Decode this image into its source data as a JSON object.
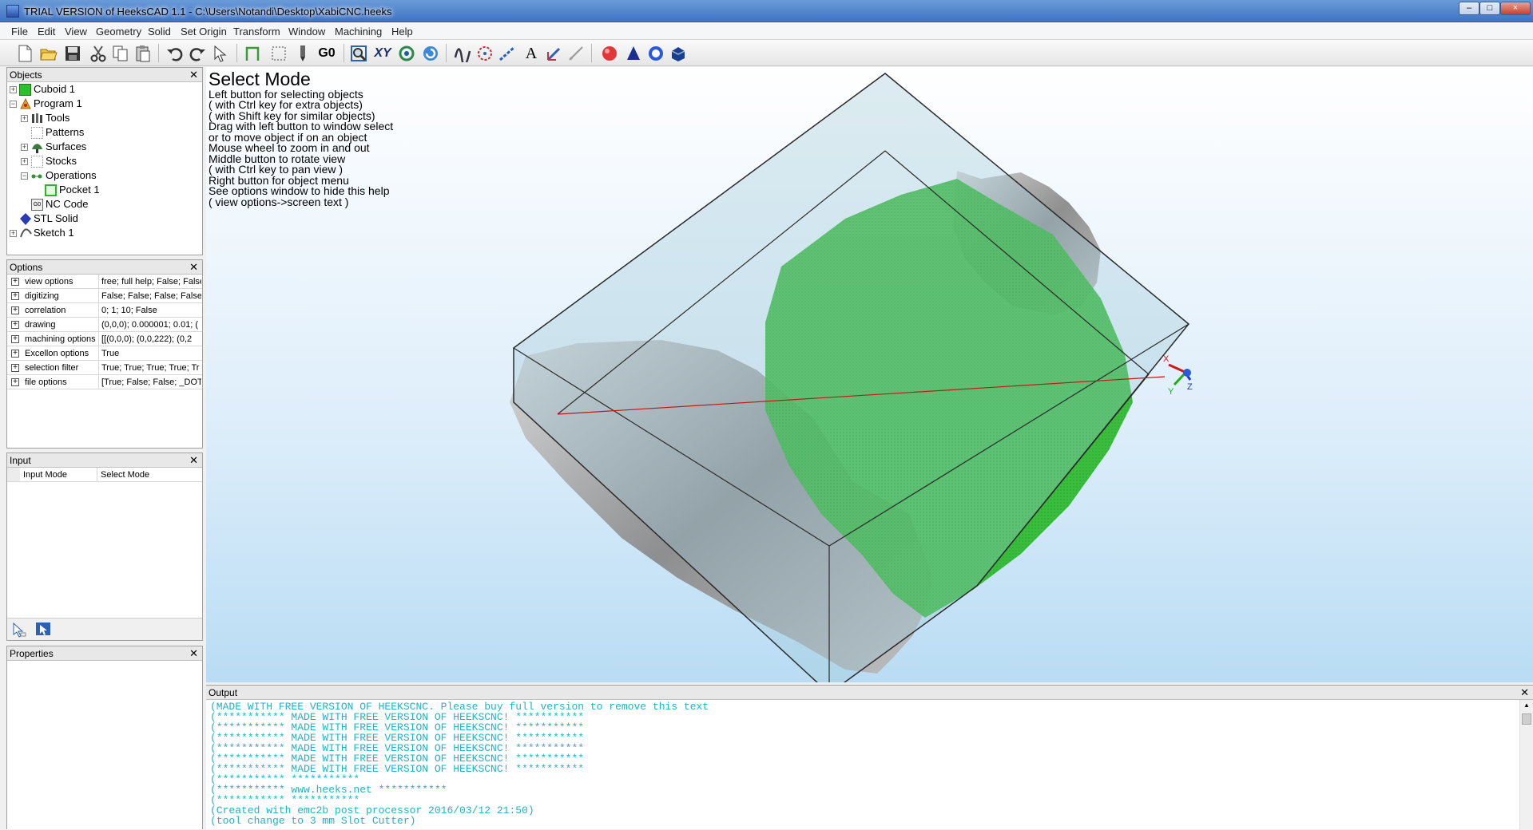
{
  "window": {
    "title": "TRIAL VERSION of HeeksCAD 1.1 - C:\\Users\\Notandi\\Desktop\\XabiCNC.heeks",
    "minimize": "–",
    "maximize": "□",
    "close": "×"
  },
  "menu": [
    "File",
    "Edit",
    "View",
    "Geometry",
    "Solid",
    "Set Origin",
    "Transform",
    "Window",
    "Machining",
    "Help"
  ],
  "toolbar": {
    "text_buttons": {
      "xy": "XY",
      "g0": "G0",
      "text": "A"
    },
    "icons": [
      "new-icon",
      "open-icon",
      "save-icon",
      "cut-icon",
      "copy-icon",
      "paste-icon",
      "undo-icon",
      "redo-icon",
      "select-icon",
      "profile-icon",
      "pocket-icon",
      "drill-icon",
      "g0-icon",
      "zoom-window-icon",
      "view-xy-icon",
      "fit-view-icon",
      "redraw-icon",
      "spline-icon",
      "circle-icon",
      "lines-icon",
      "text-icon",
      "coordinate-system-icon",
      "dimension-icon",
      "sphere-icon",
      "cone-icon",
      "cylinder-icon",
      "cuboid-icon"
    ]
  },
  "objects_panel": {
    "title": "Objects",
    "items": [
      {
        "label": "Cuboid 1",
        "icon": "cuboid-icon"
      },
      {
        "label": "Program 1",
        "icon": "program-icon"
      },
      {
        "label": "Tools",
        "icon": "tools-icon"
      },
      {
        "label": "Patterns",
        "icon": "patterns-icon"
      },
      {
        "label": "Surfaces",
        "icon": "surfaces-icon"
      },
      {
        "label": "Stocks",
        "icon": "stocks-icon"
      },
      {
        "label": "Operations",
        "icon": "operations-icon"
      },
      {
        "label": "Pocket 1",
        "icon": "pocket-icon"
      },
      {
        "label": "NC Code",
        "icon": "nc-code-icon"
      },
      {
        "label": "STL Solid",
        "icon": "stl-solid-icon"
      },
      {
        "label": "Sketch 1",
        "icon": "sketch-icon"
      }
    ]
  },
  "options_panel": {
    "title": "Options",
    "rows": [
      {
        "name": "view options",
        "value": "free; full help; False; False"
      },
      {
        "name": "digitizing",
        "value": "False; False; False; False;"
      },
      {
        "name": "correlation",
        "value": "0; 1; 10; False"
      },
      {
        "name": "drawing",
        "value": "(0,0,0); 0.000001; 0.01; ("
      },
      {
        "name": "machining options",
        "value": "[[(0,0,0); (0,0,222); (0,2"
      },
      {
        "name": "Excellon options",
        "value": "True"
      },
      {
        "name": "selection filter",
        "value": "True; True; True; True; Tr"
      },
      {
        "name": "file options",
        "value": "[True; False; False; _DOT"
      }
    ]
  },
  "input_panel": {
    "title": "Input",
    "name": "Input Mode",
    "value": "Select Mode"
  },
  "properties_panel": {
    "title": "Properties"
  },
  "viewport": {
    "help_title": "Select Mode",
    "help_lines": [
      "Left button for selecting objects",
      "( with Ctrl key for extra objects)",
      "( with Shift key for similar objects)",
      "Drag with left button to window select",
      "or to move object if on an object",
      "Mouse wheel to zoom in and out",
      "Middle button to rotate view",
      "( with Ctrl key to pan view )",
      "Right button for object menu",
      "See options window to hide this help",
      "( view options->screen text )"
    ],
    "axis_labels": {
      "x": "X",
      "y": "Y",
      "z": "Z"
    }
  },
  "output_panel": {
    "title": "Output",
    "lines": [
      "(MADE WITH FREE VERSION OF HEEKSCNC. Please buy full version to remove this text",
      "(*********** MADE WITH FREE VERSION OF HEEKSCNC! ***********",
      "(*********** MADE WITH FREE VERSION OF HEEKSCNC! ***********",
      "(*********** MADE WITH FREE VERSION OF HEEKSCNC! ***********",
      "(*********** MADE WITH FREE VERSION OF HEEKSCNC! ***********",
      "(*********** MADE WITH FREE VERSION OF HEEKSCNC! ***********",
      "(*********** MADE WITH FREE VERSION OF HEEKSCNC! ***********",
      "(*********** ***********",
      "(*********** www.heeks.net ***********",
      "(*********** ***********",
      "(Created with emc2b post processor 2016/03/12 21:50)",
      "(tool change to 3 mm Slot Cutter)"
    ]
  }
}
